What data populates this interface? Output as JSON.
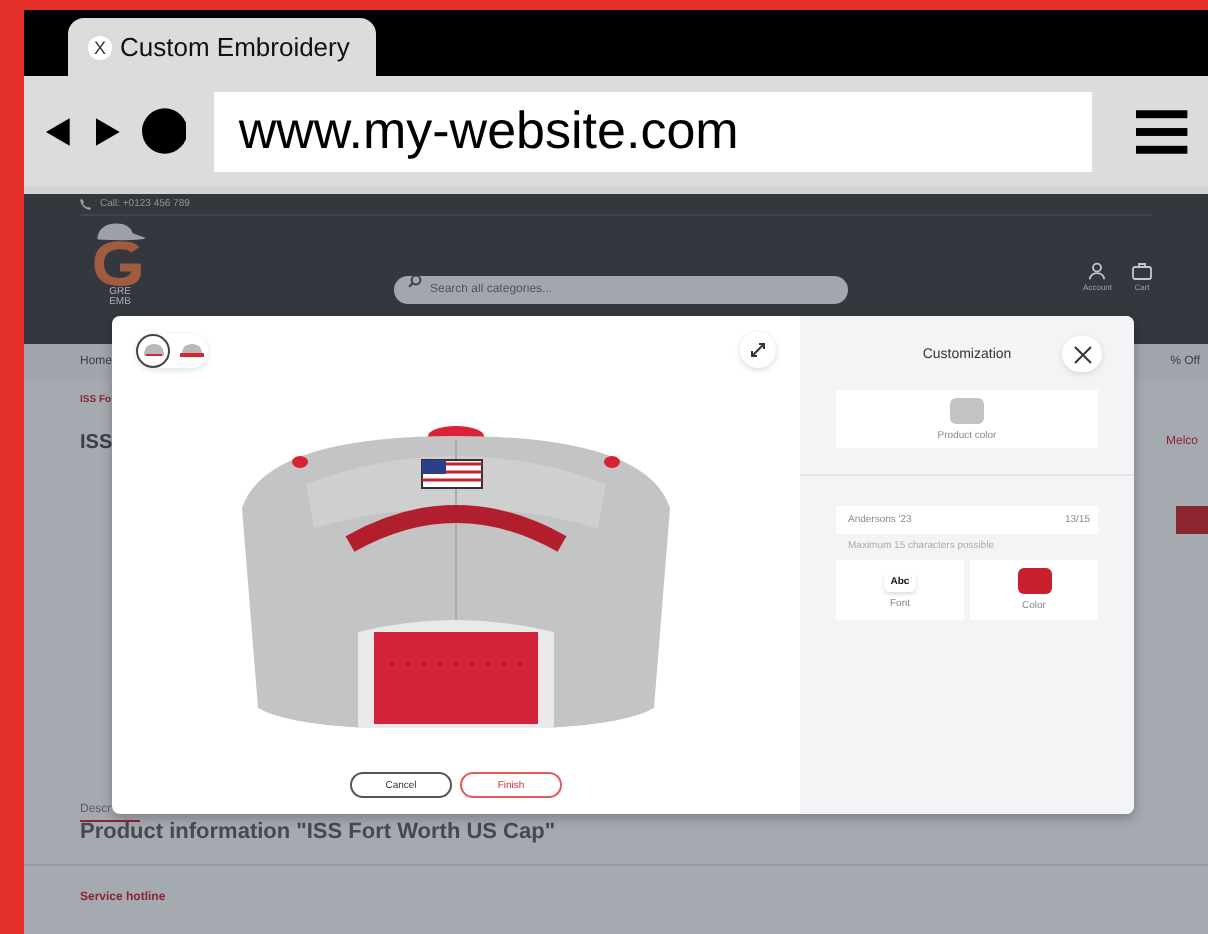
{
  "browser": {
    "tab": {
      "close": "X",
      "title": "Custom Embroidery"
    },
    "url": "www.my-website.com"
  },
  "site": {
    "phone": "Call: +0123 456 789",
    "logo_lines": [
      "GRE",
      "EMB"
    ],
    "search": {
      "placeholder": "Search all categories..."
    },
    "header_actions": [
      "Account",
      "Cart"
    ],
    "nav": [
      "Home",
      "% Off"
    ],
    "breadcrumb": "ISS Fo",
    "heading": "ISS",
    "side_link": "Melco",
    "detail_tab": "Descr",
    "product_info": "Product information \"ISS Fort Worth US Cap\"",
    "service_title": "Service hotline"
  },
  "modal": {
    "views": [
      {
        "selected": true
      },
      {
        "selected": false
      }
    ],
    "title": "Customization",
    "product_color": {
      "label": "Product color",
      "color": "#c3c3c3"
    },
    "text_field": {
      "value": "Andersons '23",
      "counter": "13/15"
    },
    "hint": "Maximum 15 characters possible",
    "options": [
      {
        "kind": "font",
        "sample": "Abc",
        "label": "Font"
      },
      {
        "kind": "color",
        "color": "#c8202e",
        "label": "Color"
      }
    ],
    "buttons": [
      {
        "label": "Cancel",
        "kind": "secondary"
      },
      {
        "label": "Finish",
        "kind": "primary"
      }
    ]
  }
}
